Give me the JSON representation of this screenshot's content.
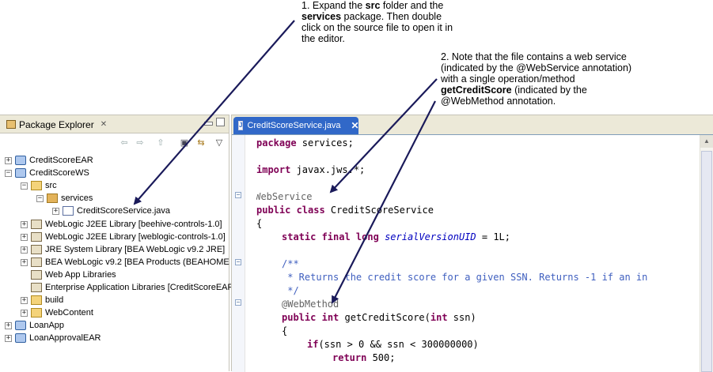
{
  "notes": {
    "note1": {
      "line1": "1. Expand the ",
      "b1": "src",
      "line1b": " folder and the",
      "b2": "services",
      "line2": " package.  Then double",
      "line3": "click on the source file to open it in",
      "line4": "the editor."
    },
    "note2": {
      "line1": "2. Note that the file contains a web service",
      "line2": "(indicated by the @WebService annotation)",
      "line3": "with a single operation/method",
      "b1": "getCreditScore",
      "line4": " (indicated by the",
      "line5": "@WebMethod annotation."
    }
  },
  "package_explorer": {
    "tab_label": "Package Explorer",
    "tab_close": "✕",
    "toolbar_icons": [
      "back-arrow-icon",
      "forward-arrow-icon",
      "up-icon",
      "collapse-all-icon",
      "link-editor-icon",
      "view-menu-icon"
    ],
    "tree": [
      {
        "label": "CreditScoreEAR",
        "twisty": "+",
        "icon": "project"
      },
      {
        "label": "CreditScoreWS",
        "twisty": "−",
        "icon": "project"
      },
      {
        "label": "src",
        "twisty": "−",
        "icon": "folder"
      },
      {
        "label": "services",
        "twisty": "−",
        "icon": "package"
      },
      {
        "label": "CreditScoreService.java",
        "twisty": "+",
        "icon": "java"
      },
      {
        "label": "WebLogic J2EE Library [beehive-controls-1.0]",
        "twisty": "+",
        "icon": "library"
      },
      {
        "label": "WebLogic J2EE Library [weblogic-controls-1.0]",
        "twisty": "+",
        "icon": "library"
      },
      {
        "label": "JRE System Library [BEA WebLogic v9.2 JRE]",
        "twisty": "+",
        "icon": "library"
      },
      {
        "label": "BEA WebLogic v9.2 [BEA Products (BEAHOME 2",
        "twisty": "+",
        "icon": "library"
      },
      {
        "label": "Web App Libraries",
        "twisty": "",
        "icon": "library"
      },
      {
        "label": "Enterprise Application Libraries [CreditScoreEAR",
        "twisty": "",
        "icon": "library"
      },
      {
        "label": "build",
        "twisty": "+",
        "icon": "folder"
      },
      {
        "label": "WebContent",
        "twisty": "+",
        "icon": "folder"
      },
      {
        "label": "LoanApp",
        "twisty": "+",
        "icon": "project"
      },
      {
        "label": "LoanApprovalEAR",
        "twisty": "+",
        "icon": "project"
      }
    ]
  },
  "editor": {
    "tab_label": "CreditScoreService.java",
    "tab_close": "✕",
    "code": {
      "l1_kw": "package",
      "l1_rest": " services;",
      "l2_kw": "import",
      "l2_rest": " javax.jws.*;",
      "l3_ann": "@WebService",
      "l4_kw": "public class",
      "l4_rest": " CreditScoreService",
      "l5": "{",
      "l6_kw": "static final long",
      "l6_fld": "serialVersionUID",
      "l6_rest": " = 1L;",
      "l7_cm": "/**",
      "l8_cm": " * Returns the credit score for a given SSN. Returns -1 if an in",
      "l9_cm": " */",
      "l10_ann": "@WebMethod",
      "l11_kw1": "public",
      "l11_kw2": "int",
      "l11_mid": " getCreditScore(",
      "l11_kw3": "int",
      "l11_end": " ssn)",
      "l12": "{",
      "l13_kw": "if",
      "l13_rest": "(ssn > 0 && ssn < 300000000)",
      "l14_kw": "return",
      "l14_rest": " 500;"
    }
  },
  "colors": {
    "keyword": "#7f0055",
    "annotation": "#646464",
    "comment": "#3f5fbf",
    "field": "#0000c0",
    "active_tab": "#3168c8",
    "arrow": "#1a1a5a"
  }
}
